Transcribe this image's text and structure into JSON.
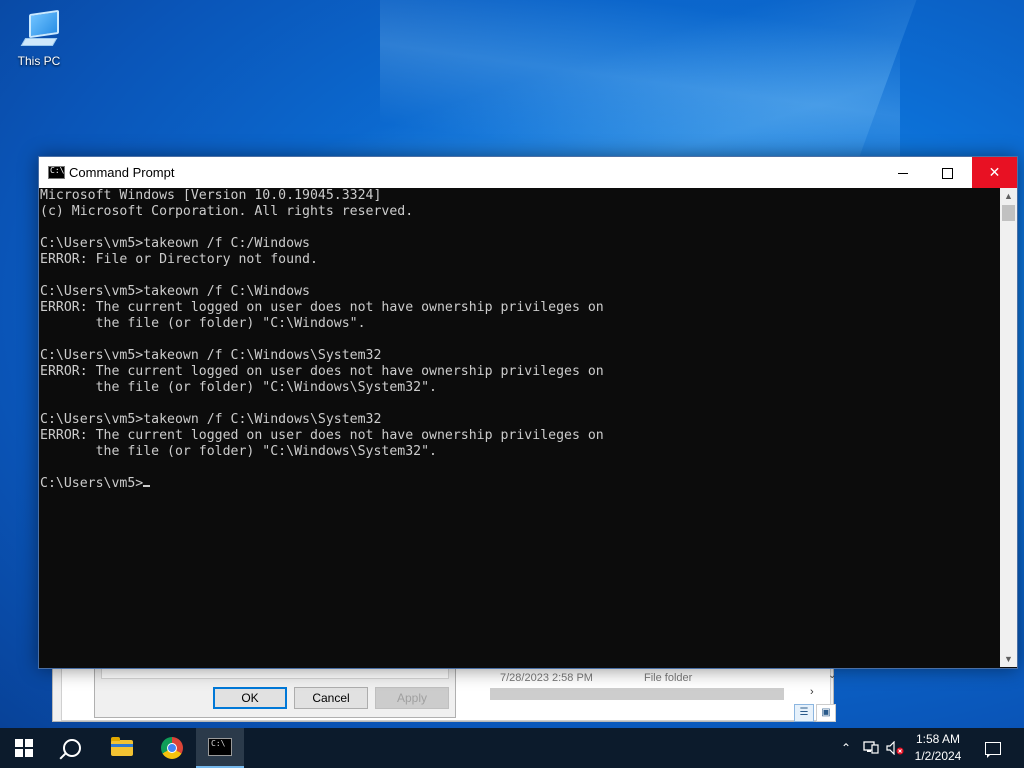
{
  "desktop": {
    "icons": [
      {
        "label": "This PC",
        "icon": "computer-icon"
      }
    ]
  },
  "background_window": {
    "row_date": "7/28/2023 2:58 PM",
    "row_type": "File folder"
  },
  "properties_dialog": {
    "ok_label": "OK",
    "cancel_label": "Cancel",
    "apply_label": "Apply"
  },
  "cmd_window": {
    "title": "Command Prompt",
    "buttons": {
      "minimize": "minimize-icon",
      "maximize": "maximize-icon",
      "close": "close-icon"
    },
    "console_lines": [
      "Microsoft Windows [Version 10.0.19045.3324]",
      "(c) Microsoft Corporation. All rights reserved.",
      "",
      "C:\\Users\\vm5>takeown /f C:/Windows",
      "ERROR: File or Directory not found.",
      "",
      "C:\\Users\\vm5>takeown /f C:\\Windows",
      "ERROR: The current logged on user does not have ownership privileges on",
      "       the file (or folder) \"C:\\Windows\".",
      "",
      "C:\\Users\\vm5>takeown /f C:\\Windows\\System32",
      "ERROR: The current logged on user does not have ownership privileges on",
      "       the file (or folder) \"C:\\Windows\\System32\".",
      "",
      "C:\\Users\\vm5>takeown /f C:\\Windows\\System32",
      "ERROR: The current logged on user does not have ownership privileges on",
      "       the file (or folder) \"C:\\Windows\\System32\".",
      ""
    ],
    "prompt": "C:\\Users\\vm5>"
  },
  "taskbar": {
    "items": [
      {
        "name": "start-button",
        "icon": "windows-logo-icon"
      },
      {
        "name": "search-button",
        "icon": "search-icon"
      },
      {
        "name": "file-explorer-button",
        "icon": "folder-icon"
      },
      {
        "name": "chrome-button",
        "icon": "chrome-icon"
      },
      {
        "name": "command-prompt-button",
        "icon": "cmd-icon",
        "active": true
      }
    ],
    "tray_icons": [
      "chevron-up-icon",
      "network-icon",
      "volume-muted-icon"
    ],
    "time": "1:58 AM",
    "date": "1/2/2024",
    "notification_icon": "notification-icon"
  }
}
